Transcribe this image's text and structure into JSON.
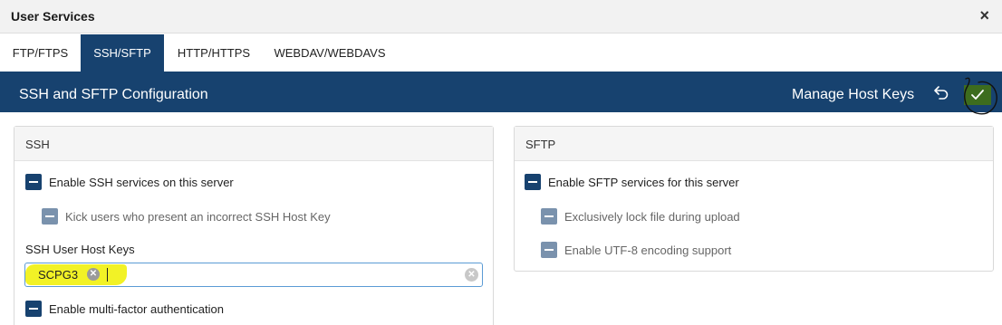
{
  "window": {
    "title": "User Services",
    "close_glyph": "×"
  },
  "tabs": [
    {
      "label": "FTP/FTPS",
      "active": false
    },
    {
      "label": "SSH/SFTP",
      "active": true
    },
    {
      "label": "HTTP/HTTPS",
      "active": false
    },
    {
      "label": "WEBDAV/WEBDAVS",
      "active": false
    }
  ],
  "config_bar": {
    "title": "SSH and SFTP Configuration",
    "manage_label": "Manage Host Keys",
    "undo_icon": "undo-icon",
    "save_icon": "check-icon"
  },
  "ssh": {
    "heading": "SSH",
    "enable_label": "Enable SSH services on this server",
    "kick_label": "Kick users who present an incorrect SSH Host Key",
    "host_keys_label": "SSH User Host Keys",
    "host_key_tag": "SCPG3",
    "mfa_label": "Enable multi-factor authentication"
  },
  "sftp": {
    "heading": "SFTP",
    "enable_label": "Enable SFTP services for this server",
    "lock_label": "Exclusively lock file during upload",
    "utf8_label": "Enable UTF-8 encoding support"
  },
  "colors": {
    "primary": "#17426f",
    "save_green": "#3d6c1e",
    "highlight": "#f0f000"
  }
}
